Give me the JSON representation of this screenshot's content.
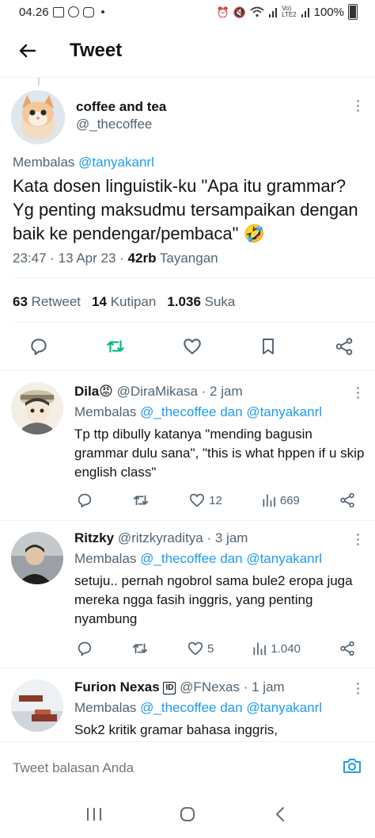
{
  "status_bar": {
    "time": "04.26",
    "battery": "100%"
  },
  "header": {
    "title": "Tweet"
  },
  "main_tweet": {
    "name": "coffee and tea",
    "handle": "@_thecoffee",
    "replying_prefix": "Membalas",
    "replying_to": "@tanyakanrl",
    "text": "Kata dosen linguistik-ku \"Apa itu grammar? Yg penting maksudmu tersampaikan dengan baik ke pendengar/pembaca\" 🤣",
    "time": "23:47 · 13 Apr 23 · ",
    "views_count": "42rb",
    "views_label": "Tayangan",
    "retweets_count": "63",
    "retweets_label": "Retweet",
    "quotes_count": "14",
    "quotes_label": "Kutipan",
    "likes_count": "1.036",
    "likes_label": "Suka"
  },
  "replies": [
    {
      "name": "Dila😡",
      "handle": "@DiraMikasa",
      "time": "· 2 jam",
      "replying_prefix": "Membalas",
      "replying_to": "@_thecoffee dan @tanyakanrl",
      "text": "Tp ttp dibully katanya \"mending bagusin grammar dulu sana\", \"this is what hppen if u skip english class\"",
      "likes": "12",
      "views": "669"
    },
    {
      "name": "Ritzky",
      "handle": "@ritzkyraditya",
      "time": "· 3 jam",
      "replying_prefix": "Membalas",
      "replying_to": "@_thecoffee dan @tanyakanrl",
      "text": "setuju.. pernah ngobrol sama bule2 eropa juga mereka ngga fasih inggris, yang penting nyambung",
      "likes": "5",
      "views": "1.040"
    },
    {
      "name": "Furion Nexas",
      "handle": "@FNexas",
      "time": "· 1 jam",
      "replying_prefix": "Membalas",
      "replying_to": "@_thecoffee dan @tanyakanrl",
      "text": "Sok2 kritik gramar bahasa inggris,"
    }
  ],
  "composer": {
    "placeholder": "Tweet balasan Anda"
  },
  "colors": {
    "accent": "#1d9bf0",
    "retweeted": "#00ba7c",
    "muted": "#536471"
  }
}
